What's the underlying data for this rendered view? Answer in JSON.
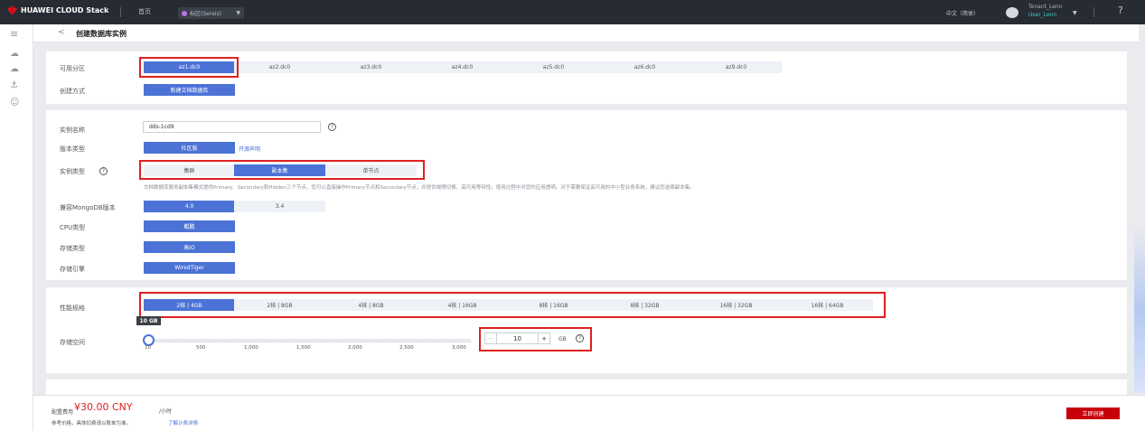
{
  "header": {
    "brand": "HUAWEI CLOUD Stack",
    "home": "首页",
    "region": "标区(Sereis)",
    "language": "中文（简体）",
    "tenant": "Tenant_Lenn",
    "user": "User_Lenn",
    "help_glyph": "?"
  },
  "page": {
    "back_glyph": "<",
    "title": "创建数据库实例"
  },
  "zone": {
    "label": "可用分区",
    "options": [
      "az1.dc0",
      "az2.dc0",
      "az3.dc0",
      "az4.dc0",
      "az5.dc0",
      "az6.dc0",
      "az9.dc0"
    ],
    "selected": "az1.dc0"
  },
  "create_method": {
    "label": "创建方式",
    "value": "新建文档数据库"
  },
  "instance_name": {
    "label": "实例名称",
    "value": "dds-1cd9"
  },
  "version_type": {
    "label": "版本类型",
    "value": "社区版",
    "link": "开源声明"
  },
  "instance_type": {
    "label": "实例类型",
    "options": [
      "集群",
      "副本集",
      "单节点"
    ],
    "selected": "副本集",
    "description": "文档数据库服务副本集模式提供Primary、Secondary和Hidden三个节点，您可以直接操作Primary节点和Secondary节点，并提供故障切换、高可用等特性。使用过程中对您的应用透明。对于需要保证高可用的中小型业务系统，建议您选择副本集。"
  },
  "mongo_version": {
    "label": "兼容MongoDB版本",
    "options": [
      "4.0",
      "3.4"
    ],
    "selected": "4.0"
  },
  "cpu_type": {
    "label": "CPU类型",
    "value": "鲲鹏"
  },
  "storage_type": {
    "label": "存储类型",
    "value": "高IO"
  },
  "storage_engine": {
    "label": "存储引擎",
    "value": "WiredTiger"
  },
  "spec": {
    "label": "性能规格",
    "options": [
      "2核 | 4GB",
      "2核 | 8GB",
      "4核 | 8GB",
      "4核 | 16GB",
      "8核 | 16GB",
      "8核 | 32GB",
      "16核 | 32GB",
      "16核 | 64GB"
    ],
    "selected": "2核 | 4GB"
  },
  "storage": {
    "label": "存储空间",
    "tooltip": "10 GB",
    "ticks": [
      "10",
      "500",
      "1,000",
      "1,500",
      "2,000",
      "2,500",
      "3,000"
    ],
    "value": "10",
    "unit": "GB",
    "minus": "−",
    "plus": "+",
    "slider_fraction": 0.0
  },
  "footer": {
    "fee_label": "配置费用",
    "fee_value": "¥30.00 CNY",
    "fee_unit": "/小时",
    "note": "参考价格，具体扣费请以账单为准。",
    "link": "了解计费详情",
    "create_button": "立即创建"
  },
  "colors": {
    "primary": "#4c72d6",
    "highlight": "#e02020",
    "create": "#c7000b"
  }
}
